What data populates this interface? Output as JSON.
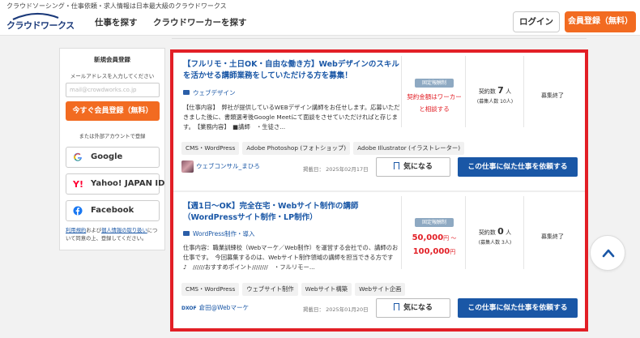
{
  "header": {
    "tagline": "クラウドソーシング・仕事依頼・求人情報は日本最大級のクラウドワークス",
    "logo": "クラウドワークス",
    "nav": [
      "仕事を探す",
      "クラウドワーカーを探す"
    ],
    "login": "ログイン",
    "register": "会員登録（無料）"
  },
  "sidebar": {
    "title": "新規会員登録",
    "email_label": "メールアドレスを入力してください",
    "email_placeholder": "mail@crowdworks.co.jp",
    "submit": "今すぐ会員登録（無料）",
    "external_label": "または外部アカウントで登録",
    "social": [
      {
        "label": "Google",
        "icon": "google-icon"
      },
      {
        "label": "Yahoo! JAPAN ID",
        "icon": "yahoo-icon"
      },
      {
        "label": "Facebook",
        "icon": "facebook-icon"
      }
    ],
    "terms_link1": "利用規約",
    "terms_mid": "および",
    "terms_link2": "個人情報の取り扱い",
    "terms_tail": "について同意の上、登録してください。"
  },
  "jobs": [
    {
      "title": "【フルリモ・土日OK・自由な働き方】Webデザインのスキルを活かせる講師業務をしていただける方を募集！",
      "category": "ウェブデザイン",
      "description": "【仕事内容】　弊社が提供しているWEBデザイン講師をお任せします。応募いただきました後に、書類選考後Google Meetにて面談をさせていただければと存じます。　【業務内容】　■講師　・生徒さ...",
      "badge": "固定報酬制",
      "budget_note": "契約金額はワーカーと相談する",
      "contract_label": "契約数",
      "contract_count": "7",
      "contract_unit": "人",
      "contract_sub": "(募集人数 10人)",
      "status": "募集終了",
      "tags": [
        "CMS・WordPress",
        "Adobe Photoshop (フォトショップ)",
        "Adobe Illustrator (イラストレーター)"
      ],
      "client": "ウェブコンサル_まひろ",
      "posted": "掲載日：  2025年02月17日",
      "fav": "気になる",
      "similar": "この仕事に似た仕事を依頼する"
    },
    {
      "title": "【週1日〜OK】完全在宅・Webサイト制作の講師（WordPressサイト制作・LP制作）",
      "category": "WordPress制作・導入",
      "description": "仕事内容：職業訓練校（Webマーケ／Web制作）を運営する会社での、講師のお仕事です。　今回募集するのは、Webサイト制作領域の講師を担当できる方です♪　//////おすすめポイント////////　・フルリモー...",
      "badge": "固定報酬制",
      "budget_min": "50,000",
      "budget_sep": "円 〜",
      "budget_max": "100,000",
      "budget_unit": "円",
      "contract_label": "契約数",
      "contract_count": "0",
      "contract_unit": "人",
      "contract_sub": "(募集人数 3人)",
      "status": "募集終了",
      "tags": [
        "CMS・WordPress",
        "ウェブサイト制作",
        "Webサイト構築",
        "Webサイト企画"
      ],
      "client_logo": "DXOF",
      "client": "倉田@Webマーケ",
      "posted": "掲載日：  2025年01月20日",
      "fav": "気になる",
      "similar": "この仕事に似た仕事を依頼する"
    }
  ],
  "colors": {
    "accent_orange": "#f26b21",
    "link_blue": "#1a57a6",
    "highlight_red": "#e21f26"
  }
}
